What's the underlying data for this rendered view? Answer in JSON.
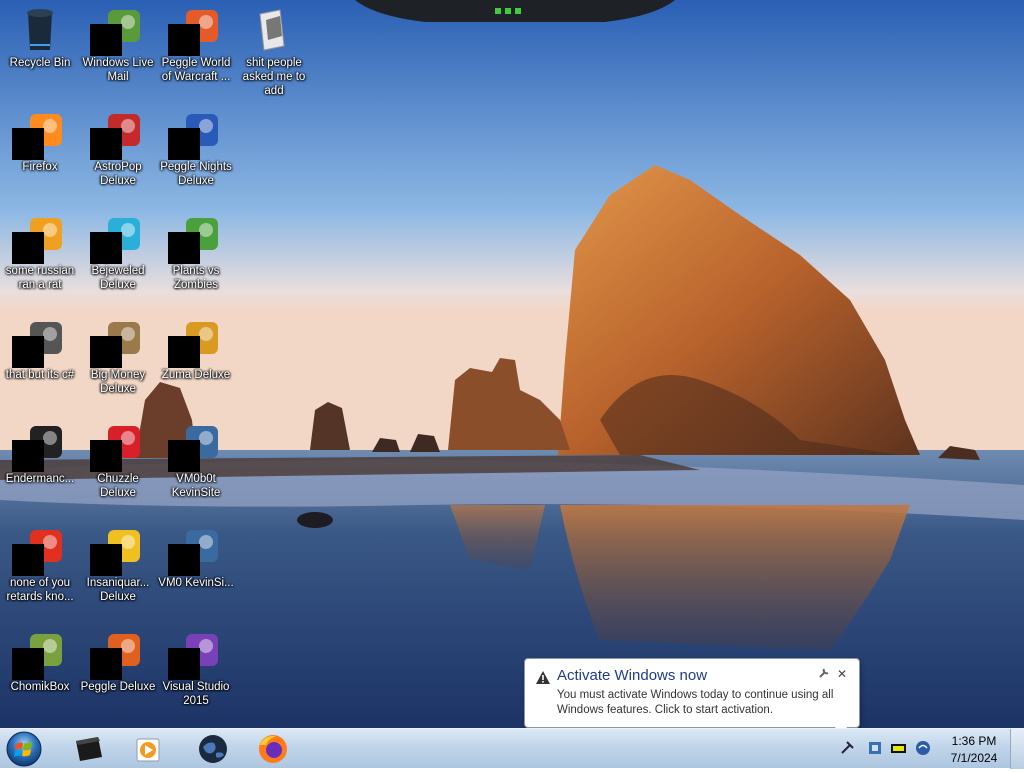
{
  "desktop": {
    "icons": [
      {
        "label": "Recycle Bin",
        "icon": "recycle-bin-icon"
      },
      {
        "label": "Windows Live Mail",
        "icon": "mail-icon"
      },
      {
        "label": "Peggle World of Warcraft ...",
        "icon": "peggle-wow-icon"
      },
      {
        "label": "shit people asked me to add",
        "icon": "folder-icon"
      },
      {
        "label": "Firefox",
        "icon": "firefox-icon"
      },
      {
        "label": "AstroPop Deluxe",
        "icon": "astropop-icon"
      },
      {
        "label": "Peggle Nights Deluxe",
        "icon": "peggle-nights-icon"
      },
      {
        "label": "some russian ran a rat",
        "icon": "program-icon"
      },
      {
        "label": "Bejeweled Deluxe",
        "icon": "bejeweled-icon"
      },
      {
        "label": "Plants vs Zombies",
        "icon": "plants-vs-zombies-icon"
      },
      {
        "label": "that but its c#",
        "icon": "shortcut-icon"
      },
      {
        "label": "Big Money Deluxe",
        "icon": "big-money-icon"
      },
      {
        "label": "Zuma Deluxe",
        "icon": "zuma-icon"
      },
      {
        "label": "Endermanc...",
        "icon": "terminal-icon"
      },
      {
        "label": "Chuzzle Deluxe",
        "icon": "chuzzle-icon"
      },
      {
        "label": "VM0b0t KevinSite",
        "icon": "vm-icon"
      },
      {
        "label": "none of you retards kno...",
        "icon": "app-icon"
      },
      {
        "label": "Insaniquar... Deluxe",
        "icon": "insaniquarium-icon"
      },
      {
        "label": "VM0 KevinSi...",
        "icon": "vm-icon"
      },
      {
        "label": "ChomikBox",
        "icon": "chomikbox-icon"
      },
      {
        "label": "Peggle Deluxe",
        "icon": "peggle-icon"
      },
      {
        "label": "Visual Studio 2015",
        "icon": "visual-studio-icon"
      }
    ]
  },
  "notification": {
    "title": "Activate Windows now",
    "message": "You must activate Windows today to continue using all Windows features. Click to start activation."
  },
  "taskbar": {
    "pinned": [
      {
        "icon": "command-box-icon"
      },
      {
        "icon": "media-player-icon"
      },
      {
        "icon": "globe-icon"
      },
      {
        "icon": "firefox-icon"
      }
    ],
    "clock": {
      "time": "1:36 PM",
      "date": "7/1/2024"
    }
  },
  "colors": {
    "balloon_title": "#1e3c8c",
    "taskbar": "#c1d5ea"
  }
}
